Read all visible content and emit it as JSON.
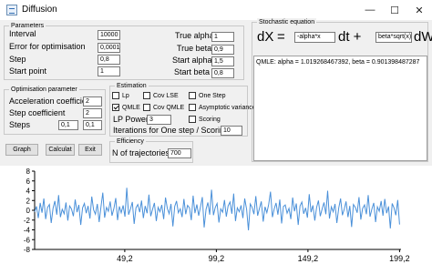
{
  "window": {
    "title": "Diffusion"
  },
  "parameters": {
    "legend": "Parameters",
    "interval_label": "Interval",
    "interval_value": "10000",
    "error_label": "Error for optimisation",
    "error_value": "0,0001",
    "step_label": "Step",
    "step_value": "0,8",
    "start_point_label": "Start point",
    "start_point_value": "1",
    "true_alpha_label": "True alpha",
    "true_alpha_value": "1",
    "true_beta_label": "True beta",
    "true_beta_value": "0,9",
    "start_alpha_label": "Start alpha",
    "start_alpha_value": "1,5",
    "start_beta_label": "Start beta",
    "start_beta_value": "0,8"
  },
  "optimisation": {
    "legend": "Optimisation parameter",
    "accel_label": "Acceleration coefficient",
    "accel_value": "2",
    "step_coef_label": "Step coefficient",
    "step_coef_value": "2",
    "steps_label": "Steps",
    "steps_from": "0,1",
    "steps_to": "0,1"
  },
  "estimation": {
    "legend": "Estimation",
    "lp": {
      "label": "Lp",
      "checked": false
    },
    "cov_lse": {
      "label": "Cov LSE",
      "checked": false
    },
    "one_step": {
      "label": "One Step",
      "checked": false
    },
    "qmle": {
      "label": "QMLE",
      "checked": true
    },
    "cov_qmle": {
      "label": "Cov QMLE",
      "checked": false
    },
    "asymptotic": {
      "label": "Asymptotic variance",
      "checked": false
    },
    "scoring": {
      "label": "Scoring",
      "checked": false
    },
    "lp_power_label": "LP Power",
    "lp_power_value": "3",
    "iterations_label": "Iterations for One step / Scoring",
    "iterations_value": "10"
  },
  "efficiency": {
    "legend": "Efficiency",
    "trajectories_label": "N of trajectories",
    "trajectories_value": "700"
  },
  "stochastic": {
    "legend": "Stochastic equation",
    "dx": "dX",
    "eq": "=",
    "drift": "-alpha*x",
    "dt": "dt +",
    "diffusion": "beta*sqrt(x)",
    "dw": "dW",
    "result": "QMLE: alpha = 1.01926846739​2, beta = 0.901398487287"
  },
  "buttons": {
    "graph": "Graph",
    "calculate": "Calculat",
    "exit": "Exit"
  },
  "chart_data": {
    "type": "line",
    "title": "",
    "xlabel": "",
    "ylabel": "",
    "xlim": [
      0,
      200
    ],
    "ylim": [
      -8,
      8
    ],
    "x_ticks": [
      "49,2",
      "99,2",
      "149,2",
      "199,2"
    ],
    "x_tick_values": [
      49.2,
      99.2,
      149.2,
      199.2
    ],
    "y_ticks": [
      "8",
      "6",
      "4",
      "2",
      "0",
      "-2",
      "-4",
      "-6",
      "-8"
    ],
    "y_tick_values": [
      8,
      6,
      4,
      2,
      0,
      -2,
      -4,
      -6,
      -8
    ],
    "grid": false,
    "series": [
      {
        "color": "#4a90d9",
        "x_start": 0,
        "x_end": 199.2,
        "values": [
          -0.3,
          0.8,
          -1.6,
          1.5,
          -0.5,
          2.4,
          -1.8,
          0.6,
          1.2,
          -2.6,
          0.4,
          1.9,
          -0.9,
          3.1,
          -1.4,
          0.2,
          -0.7,
          1.6,
          -2.1,
          0.9,
          0.3,
          -1.2,
          2.2,
          -0.4,
          1.1,
          -3.0,
          0.5,
          1.4,
          -0.6,
          0.9,
          -1.7,
          2.8,
          0.1,
          -0.8,
          1.3,
          -2.4,
          0.7,
          3.6,
          -1.5,
          0.6,
          -0.2,
          1.8,
          -1.1,
          0.4,
          2.5,
          -2.0,
          0.8,
          -0.5,
          1.0,
          -1.3,
          4.6,
          -0.9,
          0.3,
          1.7,
          -2.8,
          0.5,
          1.2,
          -0.4,
          2.0,
          -1.6,
          0.9,
          -0.6,
          3.2,
          -1.2,
          0.2,
          1.5,
          -2.2,
          0.6,
          -0.3,
          1.1,
          -1.8,
          2.6,
          0.4,
          -0.7,
          1.3,
          -3.3,
          0.8,
          1.9,
          -0.5,
          0.3,
          -1.4,
          2.3,
          -0.8,
          1.0,
          0.5,
          -2.0,
          3.0,
          -0.6,
          1.2,
          -1.1,
          0.7,
          2.7,
          -3.5,
          0.2,
          1.6,
          -0.9,
          4.2,
          -1.0,
          0.6,
          1.4,
          -2.5,
          0.3,
          -0.4,
          2.1,
          -1.3,
          0.9,
          1.7,
          -0.7,
          3.4,
          -2.2,
          0.5,
          -0.3,
          1.0,
          -1.6,
          2.4,
          0.2,
          -4.1,
          1.3,
          0.6,
          -0.8,
          2.9,
          -1.1,
          0.4,
          1.8,
          -2.3,
          0.7,
          -0.5,
          1.2,
          3.8,
          -1.4,
          0.3,
          1.5,
          -0.9,
          2.2,
          -2.7,
          0.8,
          1.1,
          -0.6,
          0.4,
          -1.8,
          2.6,
          -0.2,
          1.4,
          -3.0,
          0.9,
          1.7,
          -0.7,
          0.5,
          -1.5,
          3.3,
          -0.4,
          1.0,
          -2.1,
          0.6,
          2.0,
          -1.2,
          0.3,
          1.6,
          -0.8,
          4.0,
          -1.7,
          0.7,
          -0.3,
          1.3,
          -2.6,
          0.5,
          2.4,
          -1.0,
          0.2,
          1.8,
          -1.4,
          0.9,
          -3.4,
          1.2,
          0.6,
          -0.5,
          2.7,
          -1.9,
          0.4,
          1.1,
          -0.8,
          3.1,
          -1.3,
          0.3,
          1.5,
          -2.4,
          0.7,
          -0.2,
          1.9,
          -1.1,
          2.3,
          -0.6,
          0.8,
          -3.7,
          1.4,
          0.5,
          -1.0,
          2.1,
          -2.9
        ]
      }
    ]
  }
}
